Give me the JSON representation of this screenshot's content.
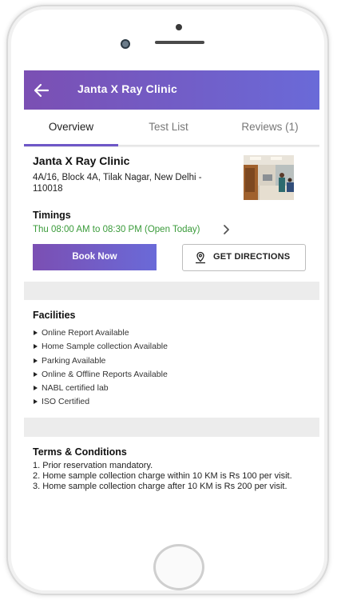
{
  "appbar": {
    "title": "Janta X Ray Clinic"
  },
  "tabs": [
    {
      "label": "Overview",
      "active": true
    },
    {
      "label": "Test List",
      "active": false
    },
    {
      "label": "Reviews (1)",
      "active": false
    }
  ],
  "clinic": {
    "name": "Janta X Ray Clinic",
    "address": "4A/16, Block  4A, Tilak Nagar, New Delhi - 110018",
    "timings_heading": "Timings",
    "timings_text": "Thu  08:00 AM to 08:30 PM (Open Today)",
    "book_label": "Book Now",
    "directions_label": "GET DIRECTIONS"
  },
  "facilities": {
    "heading": "Facilities",
    "items": [
      "Online Report Available",
      "Home Sample collection Available",
      "Parking Available",
      "Online & Offline Reports Available",
      "NABL certified lab",
      "ISO Certified"
    ]
  },
  "terms": {
    "heading": "Terms & Conditions",
    "lines": [
      "1. Prior reservation mandatory.",
      "2. Home sample collection charge within 10 KM is Rs 100 per visit.",
      "3. Home sample collection charge after 10 KM is Rs 200 per visit."
    ]
  },
  "colors": {
    "brand_gradient_start": "#7b4fb3",
    "brand_gradient_end": "#6a6ad8",
    "open_green": "#3a9b3a"
  },
  "icons": [
    "back-arrow-icon",
    "chevron-right-icon",
    "map-pin-icon"
  ]
}
